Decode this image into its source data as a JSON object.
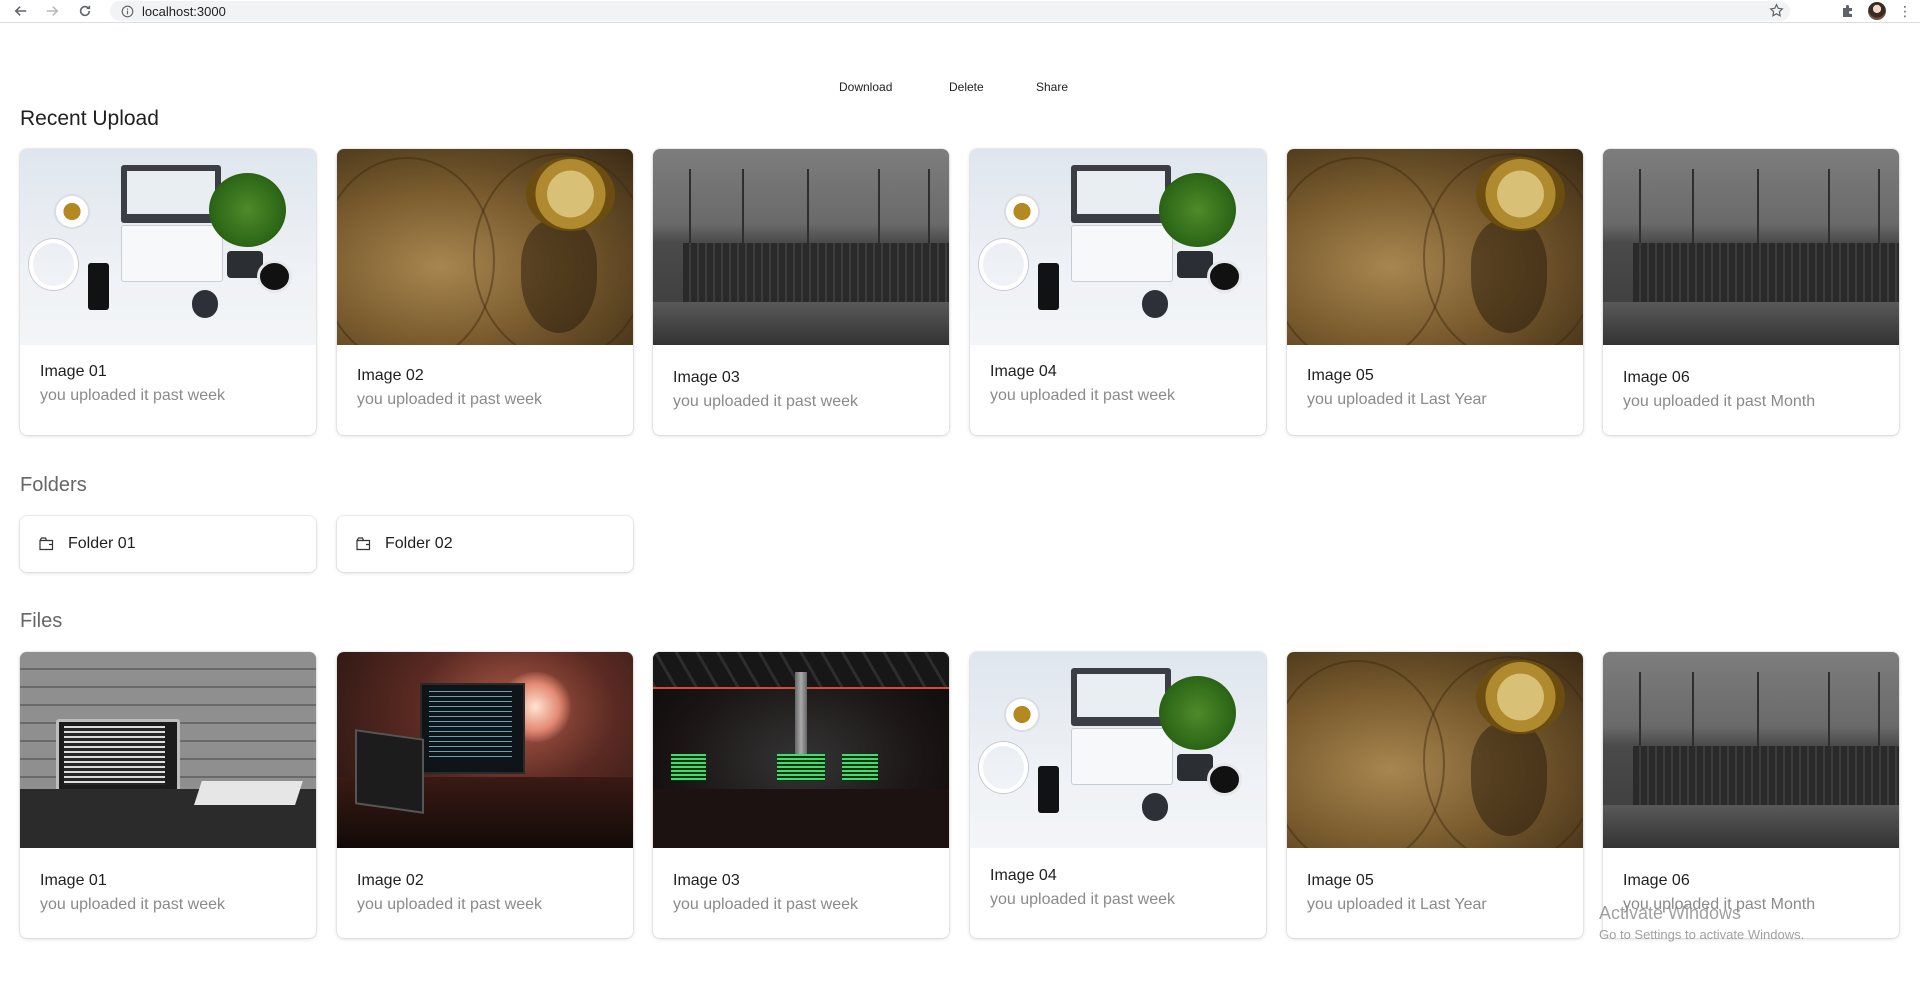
{
  "browser": {
    "url": "localhost:3000"
  },
  "toolbar": {
    "download_label": "Download",
    "delete_label": "Delete",
    "share_label": "Share"
  },
  "recent": {
    "title": "Recent Upload",
    "cards": [
      {
        "title": "Image 01",
        "subtitle": "you uploaded it past week",
        "image": "desk-flatlay"
      },
      {
        "title": "Image 02",
        "subtitle": "you uploaded it past week",
        "image": "vintage-map-compass"
      },
      {
        "title": "Image 03",
        "subtitle": "you uploaded it past week",
        "image": "container-port"
      },
      {
        "title": "Image 04",
        "subtitle": "you uploaded it past week",
        "image": "desk-flatlay"
      },
      {
        "title": "Image 05",
        "subtitle": "you uploaded it Last Year",
        "image": "vintage-map-compass"
      },
      {
        "title": "Image 06",
        "subtitle": "you uploaded it past Month",
        "image": "container-port"
      }
    ]
  },
  "folders": {
    "title": "Folders",
    "items": [
      {
        "label": "Folder 01",
        "icon": "folder-icon"
      },
      {
        "label": "Folder 02",
        "icon": "folder-icon"
      }
    ]
  },
  "files": {
    "title": "Files",
    "cards": [
      {
        "title": "Image 01",
        "subtitle": "you uploaded it past week",
        "image": "laptop-brick-wall"
      },
      {
        "title": "Image 02",
        "subtitle": "you uploaded it past week",
        "image": "monitor-red-lamp"
      },
      {
        "title": "Image 03",
        "subtitle": "you uploaded it past week",
        "image": "hacker-room"
      },
      {
        "title": "Image 04",
        "subtitle": "you uploaded it past week",
        "image": "desk-flatlay"
      },
      {
        "title": "Image 05",
        "subtitle": "you uploaded it Last Year",
        "image": "vintage-map-compass"
      },
      {
        "title": "Image 06",
        "subtitle": "you uploaded it past Month",
        "image": "container-port"
      }
    ]
  },
  "watermark": {
    "line1": "Activate Windows",
    "line2": "Go to Settings to activate Windows."
  }
}
